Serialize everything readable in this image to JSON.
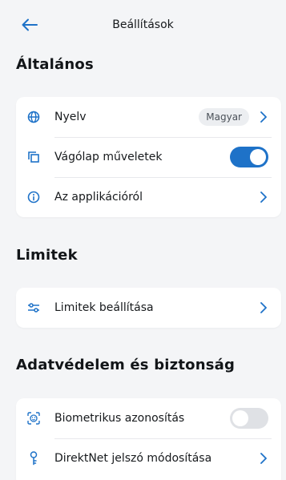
{
  "header": {
    "title": "Beállítások",
    "back_icon": "back-arrow-icon"
  },
  "colors": {
    "accent": "#1e72c8",
    "background": "#f4f5f7",
    "card": "#ffffff"
  },
  "sections": [
    {
      "title": "Általános",
      "items": [
        {
          "label": "Nyelv",
          "icon": "globe-icon",
          "value": "Magyar",
          "control": "chevron"
        },
        {
          "label": "Vágólap műveletek",
          "icon": "copy-icon",
          "control": "toggle",
          "toggle_on": true
        },
        {
          "label": "Az applikációról",
          "icon": "info-icon",
          "control": "chevron"
        }
      ]
    },
    {
      "title": "Limitek",
      "items": [
        {
          "label": "Limitek beállítása",
          "icon": "sliders-icon",
          "control": "chevron"
        }
      ]
    },
    {
      "title": "Adatvédelem és biztonság",
      "items": [
        {
          "label": "Biometrikus azonosítás",
          "icon": "face-id-icon",
          "control": "toggle",
          "toggle_on": false
        },
        {
          "label": "DirektNet jelszó módosítása",
          "icon": "key-icon",
          "control": "chevron"
        }
      ]
    }
  ]
}
